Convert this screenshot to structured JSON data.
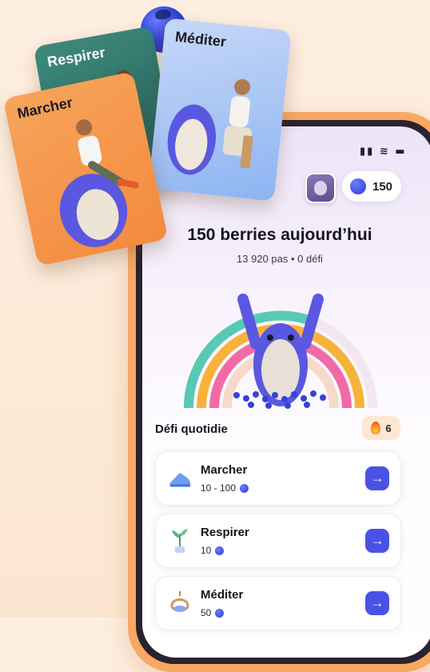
{
  "status_bar": {
    "icons": "signal-wifi-battery"
  },
  "header": {
    "berry_count": "150"
  },
  "summary": {
    "title": "150 berries aujourd’hui",
    "subtitle": "13 920 pas • 0 défi"
  },
  "daily": {
    "section_title": "Défi quotidie",
    "streak": "6"
  },
  "activities": [
    {
      "name": "Marcher",
      "reward": "10 - 100",
      "icon": "shoe-icon"
    },
    {
      "name": "Respirer",
      "reward": "10",
      "icon": "plant-icon"
    },
    {
      "name": "Méditer",
      "reward": "50",
      "icon": "hanging-chair-icon"
    }
  ],
  "promo_cards": [
    {
      "label": "Respirer"
    },
    {
      "label": "Méditer"
    },
    {
      "label": "Marcher"
    }
  ],
  "colors": {
    "accent": "#4a52e6",
    "phone_frame": "#f7a862",
    "berry": "#2e3bd0",
    "background": "#fdeee0"
  }
}
